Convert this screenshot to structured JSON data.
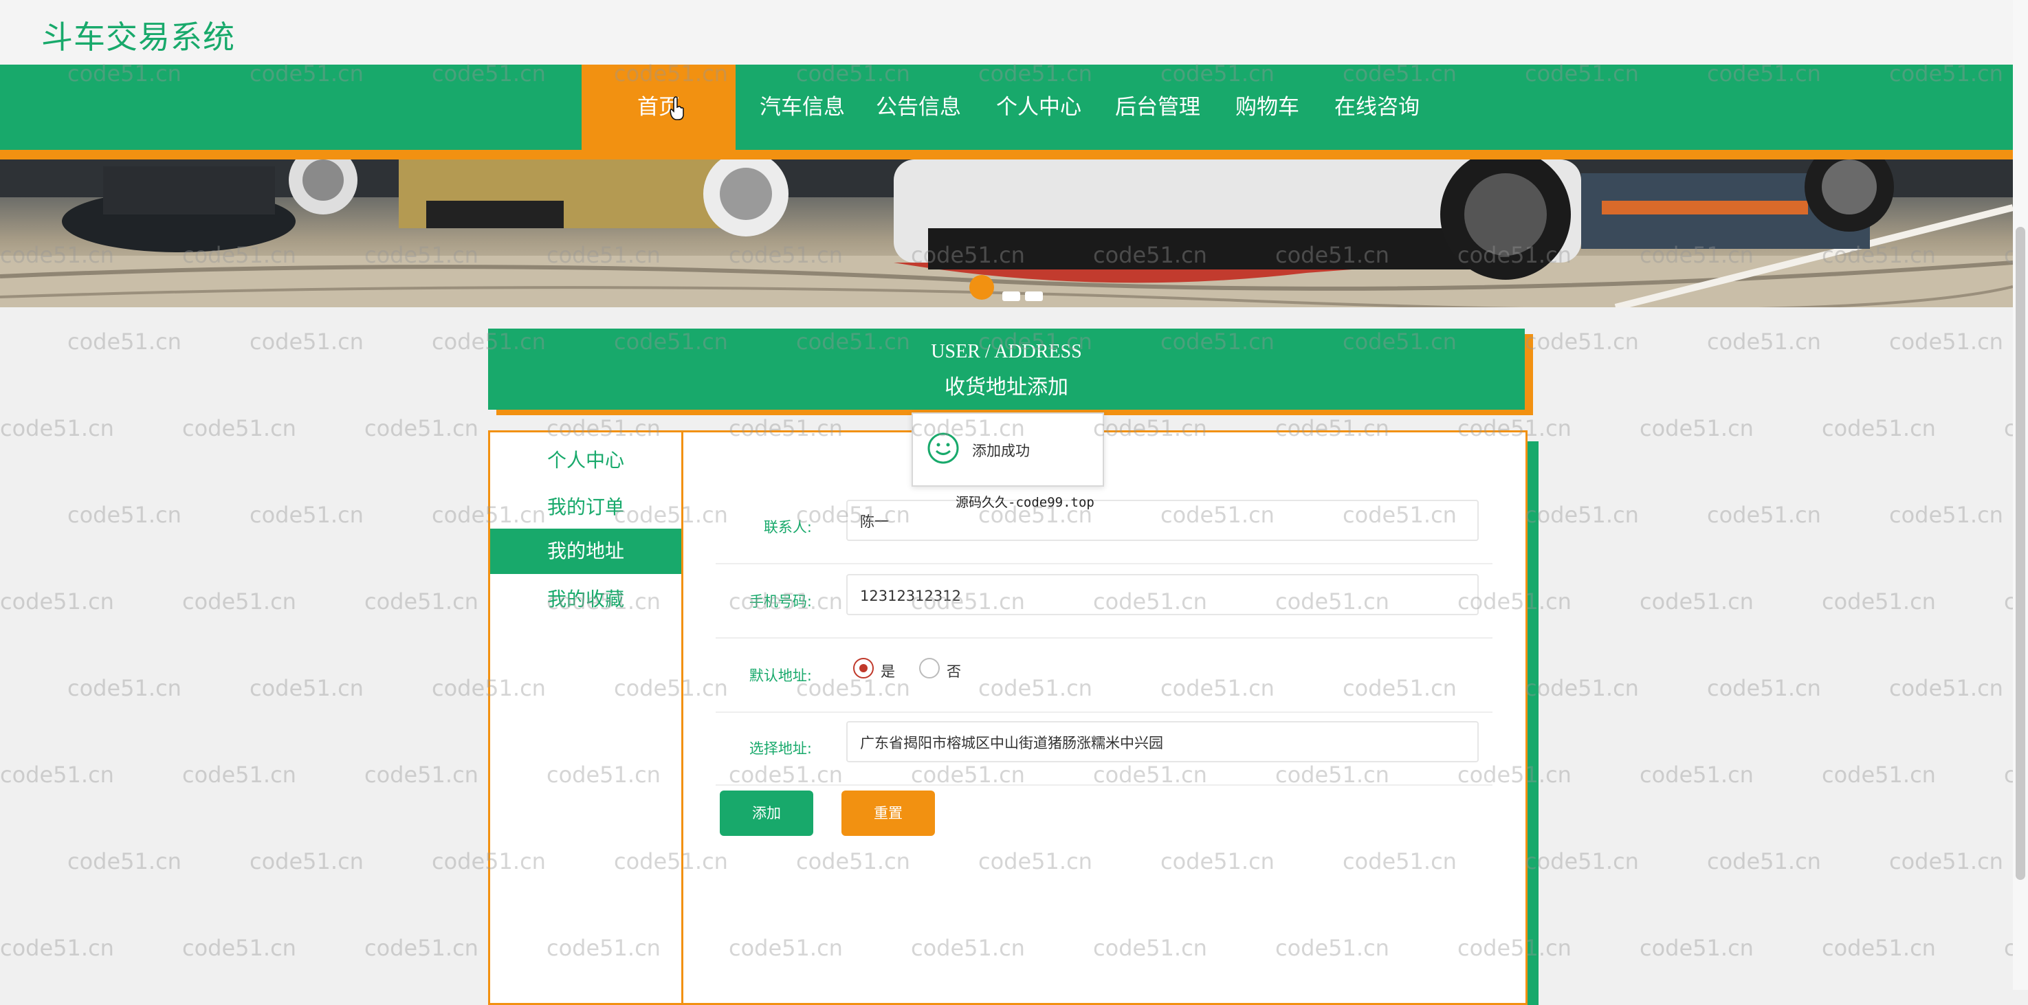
{
  "site": {
    "title": "斗车交易系统"
  },
  "nav": {
    "items": [
      {
        "label": "首页",
        "active": true
      },
      {
        "label": "汽车信息"
      },
      {
        "label": "公告信息"
      },
      {
        "label": "个人中心"
      },
      {
        "label": "后台管理"
      },
      {
        "label": "购物车"
      },
      {
        "label": "在线咨询"
      }
    ]
  },
  "banner": {
    "slide_count": 3,
    "active_slide": 1
  },
  "section": {
    "title_en": "USER / ADDRESS",
    "title_cn": "收货地址添加"
  },
  "sidebar": {
    "items": [
      {
        "label": "个人中心"
      },
      {
        "label": "我的订单"
      },
      {
        "label": "我的地址",
        "active": true
      },
      {
        "label": "我的收藏"
      }
    ]
  },
  "form": {
    "contact": {
      "label": "联系人:",
      "value": "陈一"
    },
    "phone": {
      "label": "手机号码:",
      "value": "12312312312"
    },
    "default": {
      "label": "默认地址:",
      "yes": "是",
      "no": "否",
      "selected": "是"
    },
    "address": {
      "label": "选择地址:",
      "value": "广东省揭阳市榕城区中山街道猪肠涨糯米中兴园"
    },
    "add_button": "添加",
    "reset_button": "重置"
  },
  "toast": {
    "message": "添加成功"
  },
  "overlay": {
    "text": "源码久久-code99.top"
  },
  "watermark": {
    "text": "code51.cn"
  },
  "colors": {
    "primary": "#18a96b",
    "accent": "#f29111",
    "radio": "#c0392b"
  }
}
